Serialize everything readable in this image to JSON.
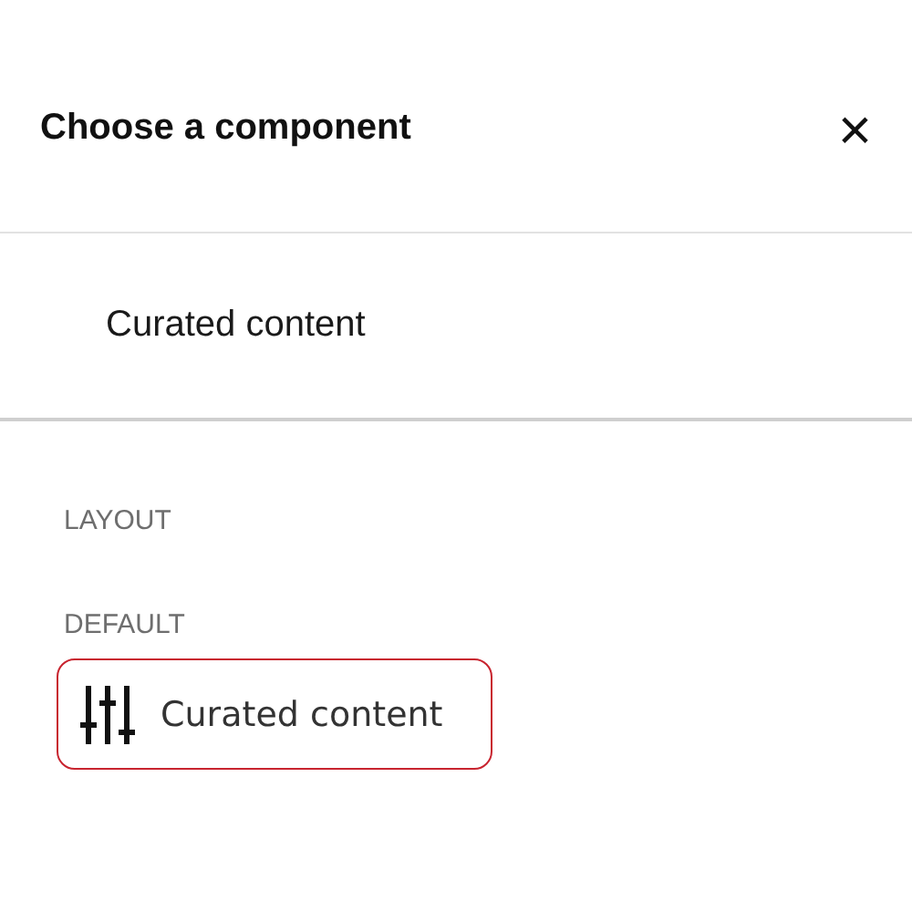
{
  "dialog": {
    "title": "Choose a component",
    "close": "×"
  },
  "current": "Curated content",
  "sections": [
    {
      "heading": "LAYOUT"
    },
    {
      "heading": "DEFAULT",
      "items": [
        {
          "label": "Curated content",
          "selected": true
        }
      ]
    }
  ]
}
